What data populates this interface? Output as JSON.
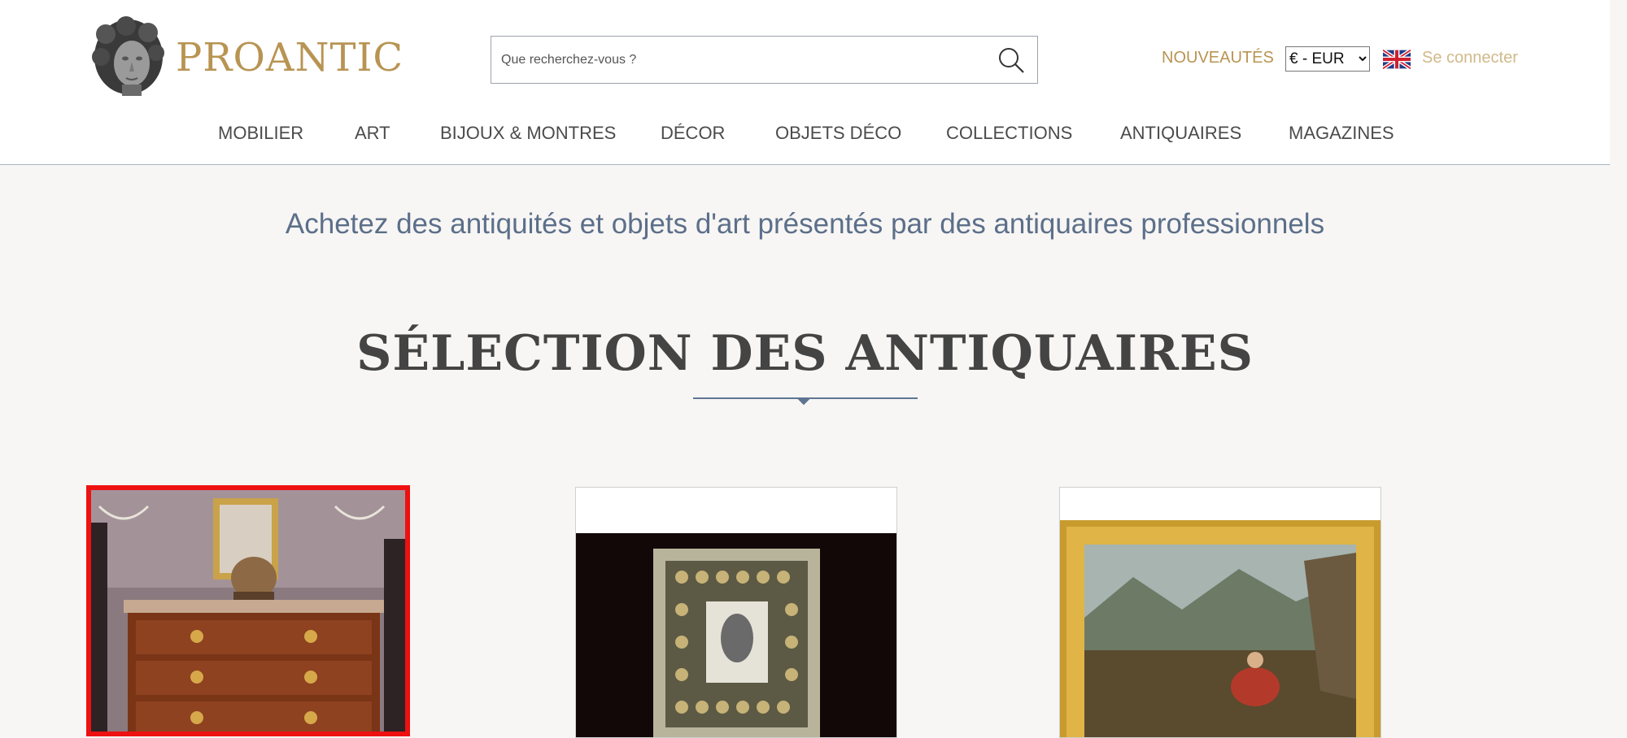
{
  "brand": {
    "name": "PROANTIC",
    "color": "#b89453"
  },
  "search": {
    "placeholder": "Que recherchez-vous ?",
    "icon": "search-icon"
  },
  "header": {
    "nouveautes": "NOUVEAUTÉS",
    "currency": "€ - EUR",
    "language_flag": "uk-flag-icon",
    "login": "Se connecter"
  },
  "nav": {
    "items": [
      {
        "label": "MOBILIER"
      },
      {
        "label": "ART"
      },
      {
        "label": "BIJOUX & MONTRES"
      },
      {
        "label": "DÉCOR"
      },
      {
        "label": "OBJETS DÉCO"
      },
      {
        "label": "COLLECTIONS"
      },
      {
        "label": "ANTIQUAIRES"
      },
      {
        "label": "MAGAZINES"
      }
    ]
  },
  "tagline": "Achetez des antiquités et objets d'art présentés par des antiquaires professionnels",
  "section": {
    "title": "SÉLECTION DES ANTIQUAIRES"
  },
  "products": [
    {
      "image": "commode-with-cherub-statue",
      "selected": true
    },
    {
      "image": "framed-religious-icon"
    },
    {
      "image": "landscape-painting-gilded-frame"
    }
  ],
  "colors": {
    "accent": "#b89453",
    "nav_text": "#4b4b4b",
    "tagline": "#5c6f8a",
    "highlight": "#ee1111"
  }
}
